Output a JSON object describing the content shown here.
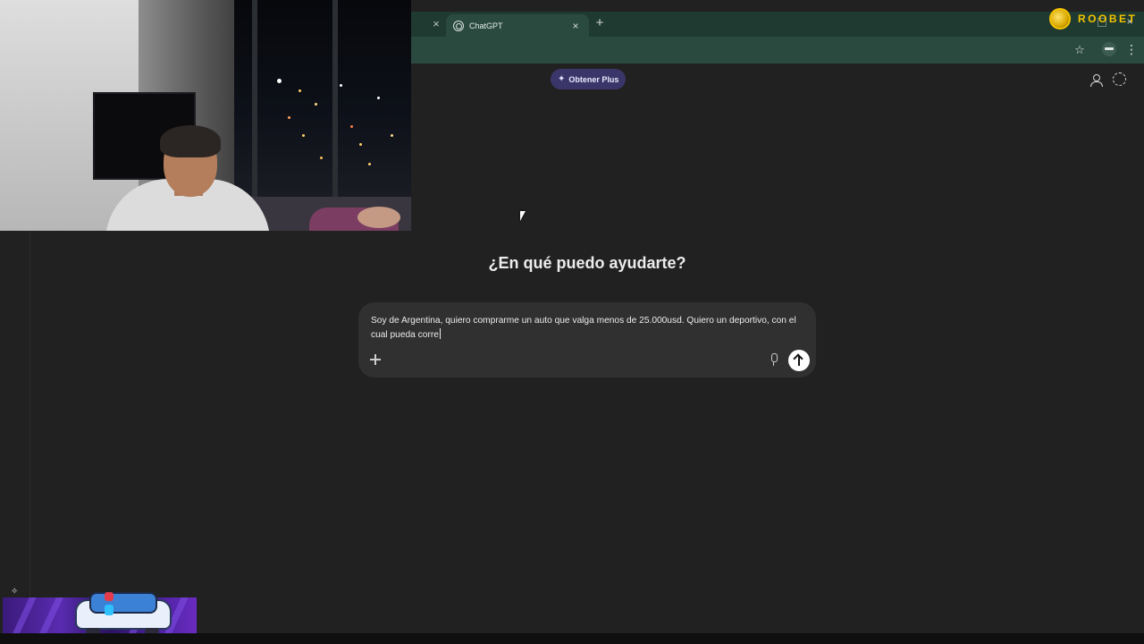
{
  "browser": {
    "tab_active_title": "ChatGPT",
    "tab_close_glyph": "×",
    "new_tab_glyph": "+",
    "icons": [
      "star-icon",
      "extension-icon",
      "kebab-menu-icon"
    ]
  },
  "overlay": {
    "brand_logo": "ROOBET"
  },
  "chat": {
    "upgrade_button_label": "Obtener Plus",
    "heading": "¿En qué puedo ayudarte?",
    "composer_text": "Soy de Argentina, quiero comprarme un auto que valga menos de 25.000usd. Quiero un deportivo, con el cual pueda corre",
    "icons": [
      "sparkle-icon",
      "user-icon",
      "temporary-chat-icon",
      "attach-icon",
      "mic-icon",
      "send-arrow-icon"
    ]
  },
  "colors": {
    "background": "#212121",
    "composer": "#303030",
    "upgrade_button": "#3b3669",
    "browser_chrome": "#2b4a3f",
    "brand_gold": "#f4c300"
  }
}
